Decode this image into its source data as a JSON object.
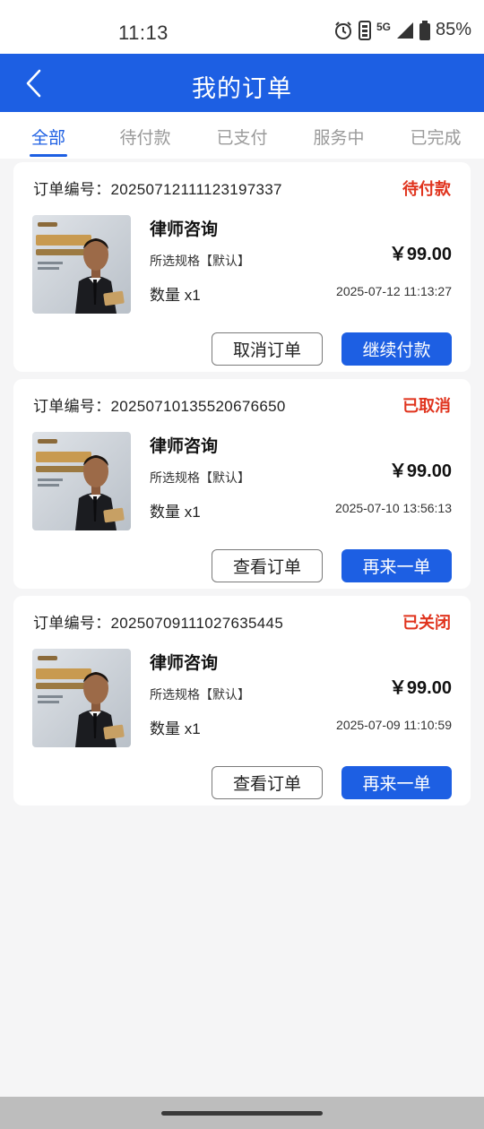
{
  "status_bar": {
    "time": "11:13",
    "network": "5G",
    "battery": "85%"
  },
  "header": {
    "title": "我的订单"
  },
  "tabs": [
    {
      "label": "全部",
      "active": true
    },
    {
      "label": "待付款",
      "active": false
    },
    {
      "label": "已支付",
      "active": false
    },
    {
      "label": "服务中",
      "active": false
    },
    {
      "label": "已完成",
      "active": false
    }
  ],
  "orders": [
    {
      "order_no": "订单编号：20250712111123197337",
      "status": "待付款",
      "product_name": "律师咨询",
      "spec": "所选规格【默认】",
      "qty": "数量 x1",
      "price": "￥99.00",
      "date": "2025-07-12 11:13:27",
      "btn_secondary": "取消订单",
      "btn_primary": "继续付款"
    },
    {
      "order_no": "订单编号：20250710135520676650",
      "status": "已取消",
      "product_name": "律师咨询",
      "spec": "所选规格【默认】",
      "qty": "数量 x1",
      "price": "￥99.00",
      "date": "2025-07-10 13:56:13",
      "btn_secondary": "查看订单",
      "btn_primary": "再来一单"
    },
    {
      "order_no": "订单编号：20250709111027635445",
      "status": "已关闭",
      "product_name": "律师咨询",
      "spec": "所选规格【默认】",
      "qty": "数量 x1",
      "price": "￥99.00",
      "date": "2025-07-09 11:10:59",
      "btn_secondary": "查看订单",
      "btn_primary": "再来一单"
    }
  ],
  "colors": {
    "brand": "#1d5fe3",
    "status_red": "#e0341e"
  },
  "icons": [
    "back-icon",
    "alarm-icon",
    "sim-icon",
    "signal-icon",
    "battery-icon"
  ]
}
